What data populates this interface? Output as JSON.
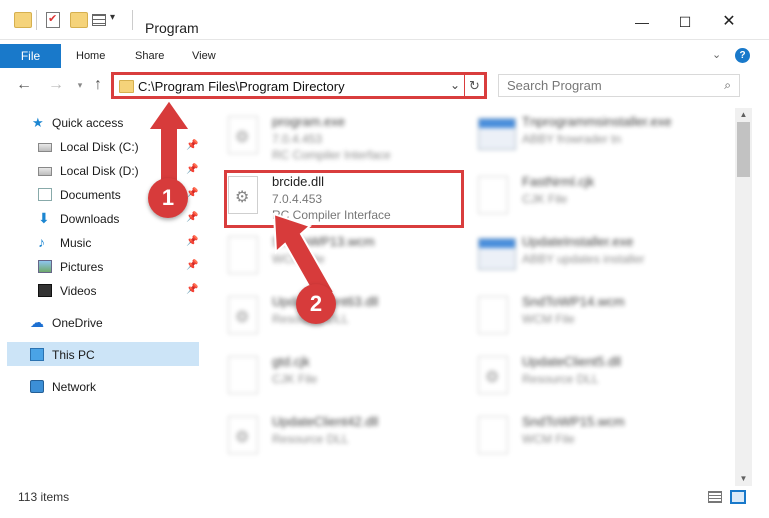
{
  "window": {
    "title": "Program",
    "minimize_glyph": "—",
    "maximize_glyph": "☐",
    "close_glyph": "✕"
  },
  "ribbon": {
    "tabs": [
      "File",
      "Home",
      "Share",
      "View"
    ],
    "expand_glyph": "⌄",
    "help_glyph": "?"
  },
  "nav": {
    "back_glyph": "←",
    "forward_glyph": "→",
    "recent_glyph": "▾",
    "up_glyph": "↑"
  },
  "address": {
    "path": "C:\\Program Files\\Program Directory",
    "dropdown_glyph": "⌄",
    "refresh_glyph": "↻"
  },
  "search": {
    "placeholder": "Search Program",
    "icon_glyph": "⌕"
  },
  "sidebar": {
    "items": [
      {
        "label": "Quick access",
        "icon": "star-icon",
        "pinned": false
      },
      {
        "label": "Local Disk (C:)",
        "icon": "drive-icon",
        "pinned": true
      },
      {
        "label": "Local Disk (D:)",
        "icon": "drive-icon",
        "pinned": true
      },
      {
        "label": "Documents",
        "icon": "documents-icon",
        "pinned": true
      },
      {
        "label": "Downloads",
        "icon": "download-icon",
        "pinned": true
      },
      {
        "label": "Music",
        "icon": "music-icon",
        "pinned": true
      },
      {
        "label": "Pictures",
        "icon": "pictures-icon",
        "pinned": true
      },
      {
        "label": "Videos",
        "icon": "videos-icon",
        "pinned": true
      },
      {
        "label": "OneDrive",
        "icon": "cloud-icon",
        "pinned": false
      },
      {
        "label": "This PC",
        "icon": "computer-icon",
        "pinned": false,
        "selected": true
      },
      {
        "label": "Network",
        "icon": "network-icon",
        "pinned": false
      }
    ],
    "pin_glyph": "📌"
  },
  "files": {
    "left": [
      {
        "name": "program.exe",
        "line2": "7.0.4.453",
        "line3": "RC Compiler Interface"
      },
      {
        "name": "brcide.dll",
        "line2": "7.0.4.453",
        "line3": "RC Compiler Interface"
      },
      {
        "name": "SndToWP13.wcm",
        "line2": "WCM File",
        "line3": ""
      },
      {
        "name": "UpdateClient63.dll",
        "line2": "Resource DLL",
        "line3": ""
      },
      {
        "name": "gtd.cjk",
        "line2": "CJK File",
        "line3": ""
      },
      {
        "name": "UpdateClient42.dll",
        "line2": "Resource DLL",
        "line3": ""
      }
    ],
    "right": [
      {
        "name": "Tnprogrammsinstaller.exe",
        "line2": "ABBY frowrader tn",
        "line3": ""
      },
      {
        "name": "FastNrml.cjk",
        "line2": "CJK File",
        "line3": ""
      },
      {
        "name": "UpdateInstaller.exe",
        "line2": "ABBY updates installer",
        "line3": ""
      },
      {
        "name": "SndToWP14.wcm",
        "line2": "WCM File",
        "line3": ""
      },
      {
        "name": "UpdateClient5.dll",
        "line2": "Resource DLL",
        "line3": ""
      },
      {
        "name": "SndToWP15.wcm",
        "line2": "WCM File",
        "line3": ""
      }
    ]
  },
  "status": {
    "item_count": "113 items"
  },
  "callouts": [
    "1",
    "2"
  ],
  "colors": {
    "accent": "#1979ca",
    "highlight": "#d93d3d",
    "selected_bg": "#cce4f7"
  }
}
